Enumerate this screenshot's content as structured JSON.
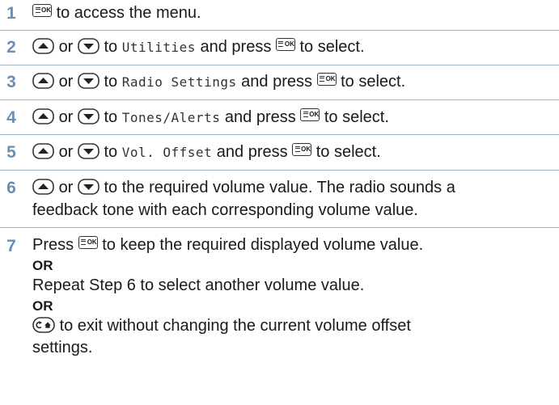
{
  "icons": {
    "ok_key": "menu-ok-key-icon",
    "up_key": "up-arrow-key-icon",
    "down_key": "down-arrow-key-icon",
    "back_home_key": "back-home-key-icon",
    "ok_key_text": "OK"
  },
  "colors": {
    "step_number": "#6a8fb5",
    "separator": "#9fb4c9"
  },
  "steps": [
    {
      "number": "1",
      "text_after_key": "to access the menu."
    },
    {
      "number": "2",
      "or": "or",
      "to": "to",
      "menu_item": "Utilities",
      "and_press": "and press",
      "to_select": "to select."
    },
    {
      "number": "3",
      "or": "or",
      "to": "to",
      "menu_item": "Radio Settings",
      "and_press": "and press",
      "to_select": "to select."
    },
    {
      "number": "4",
      "or": "or",
      "to": "to",
      "menu_item": "Tones/Alerts",
      "and_press": "and press",
      "to_select": "to select."
    },
    {
      "number": "5",
      "or": "or",
      "to": "to",
      "menu_item": "Vol. Offset",
      "and_press": "and press",
      "to_select": "to select."
    },
    {
      "number": "6",
      "or": "or",
      "line1": "to the required volume value. The radio sounds a",
      "line2": "feedback tone with each corresponding volume value."
    },
    {
      "number": "7",
      "press": "Press",
      "keep_text": "to keep the required displayed volume value.",
      "or_label_1": "OR",
      "repeat_text": "Repeat Step 6 to select another volume value.",
      "or_label_2": "OR",
      "exit_line1": "to exit without changing the current volume offset",
      "exit_line2": "settings."
    }
  ]
}
